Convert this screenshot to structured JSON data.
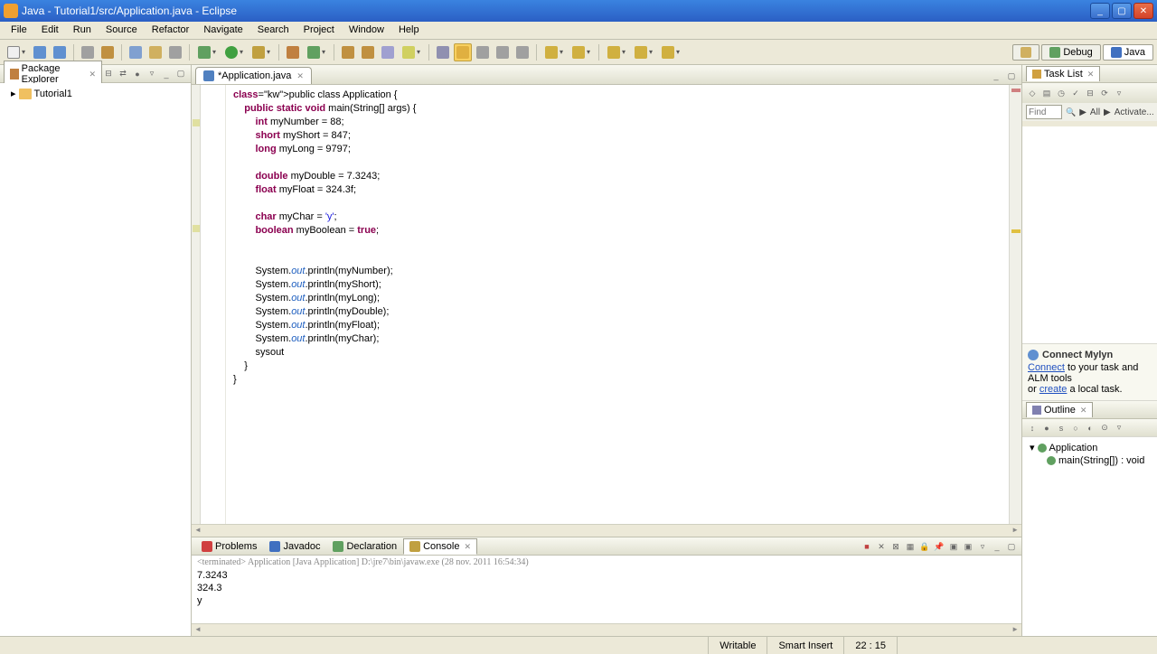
{
  "window": {
    "title": "Java - Tutorial1/src/Application.java - Eclipse"
  },
  "menu": [
    "File",
    "Edit",
    "Run",
    "Source",
    "Refactor",
    "Navigate",
    "Search",
    "Project",
    "Window",
    "Help"
  ],
  "perspectives": [
    {
      "label": "Debug",
      "color": "#60a060"
    },
    {
      "label": "Java",
      "color": "#4070c0"
    }
  ],
  "packageExplorer": {
    "title": "Package Explorer",
    "items": [
      {
        "label": "Tutorial1"
      }
    ]
  },
  "editor": {
    "tab": "*Application.java",
    "code_lines": [
      {
        "i": 0,
        "t": "public class ",
        "k": [
          "public",
          "class"
        ],
        "r": "Application {"
      },
      {
        "i": 0,
        "t": ""
      },
      {
        "i": 1,
        "t": "public static void ",
        "k": [
          "public",
          "static",
          "void"
        ],
        "r": "main(String[] args) {"
      },
      {
        "i": 2,
        "t": "int ",
        "k": [
          "int"
        ],
        "r": "myNumber = 88;"
      },
      {
        "i": 2,
        "t": "short ",
        "k": [
          "short"
        ],
        "r": "myShort = 847;"
      },
      {
        "i": 2,
        "t": "long ",
        "k": [
          "long"
        ],
        "r": "myLong = 9797;"
      },
      {
        "i": 2,
        "t": ""
      },
      {
        "i": 2,
        "t": "double ",
        "k": [
          "double"
        ],
        "r": "myDouble = 7.3243;"
      },
      {
        "i": 2,
        "t": "float ",
        "k": [
          "float"
        ],
        "r": "myFloat = 324.3f;"
      },
      {
        "i": 2,
        "t": ""
      },
      {
        "i": 2,
        "t": "char ",
        "k": [
          "char"
        ],
        "r": "myChar = ",
        "str": "'y'",
        "r2": ";"
      },
      {
        "i": 2,
        "t": "boolean ",
        "k": [
          "boolean"
        ],
        "r": "myBoolean = ",
        "k2": "true",
        "r2": ";"
      },
      {
        "i": 2,
        "t": ""
      },
      {
        "i": 2,
        "t": ""
      },
      {
        "i": 2,
        "t": "System.",
        "fld": "out",
        "r": ".println(myNumber);"
      },
      {
        "i": 2,
        "t": "System.",
        "fld": "out",
        "r": ".println(myShort);"
      },
      {
        "i": 2,
        "t": "System.",
        "fld": "out",
        "r": ".println(myLong);"
      },
      {
        "i": 2,
        "t": "System.",
        "fld": "out",
        "r": ".println(myDouble);"
      },
      {
        "i": 2,
        "t": "System.",
        "fld": "out",
        "r": ".println(myFloat);"
      },
      {
        "i": 2,
        "t": "System.",
        "fld": "out",
        "r": ".println(myChar);"
      },
      {
        "i": 2,
        "t": "sysout",
        "cursor": true
      },
      {
        "i": 1,
        "t": "}"
      },
      {
        "i": 0,
        "t": ""
      },
      {
        "i": 0,
        "t": "}"
      }
    ]
  },
  "bottom": {
    "tabs": [
      {
        "label": "Problems",
        "color": "#d04040"
      },
      {
        "label": "Javadoc",
        "color": "#4070c0"
      },
      {
        "label": "Declaration",
        "color": "#60a060"
      },
      {
        "label": "Console",
        "color": "#c0a040",
        "active": true
      }
    ],
    "console_title": "<terminated> Application [Java Application] D:\\jre7\\bin\\javaw.exe (28 nov. 2011 16:54:34)",
    "console_output": [
      "7.3243",
      "324.3",
      "y"
    ]
  },
  "right": {
    "tasklist_title": "Task List",
    "find_placeholder": "Find",
    "find_opts": [
      "▶",
      "All",
      "▶",
      "Activate..."
    ],
    "mylyn_title": "Connect Mylyn",
    "mylyn_text1": " to your task and ALM tools",
    "mylyn_link1": "Connect",
    "mylyn_text2": "or ",
    "mylyn_link2": "create",
    "mylyn_text3": " a local task.",
    "outline_title": "Outline",
    "outline_items": [
      {
        "label": "Application",
        "color": "#60a060",
        "indent": 0
      },
      {
        "label": "main(String[]) : void",
        "color": "#60a060",
        "indent": 1
      }
    ]
  },
  "status": {
    "writable": "Writable",
    "insert": "Smart Insert",
    "pos": "22 : 15"
  }
}
